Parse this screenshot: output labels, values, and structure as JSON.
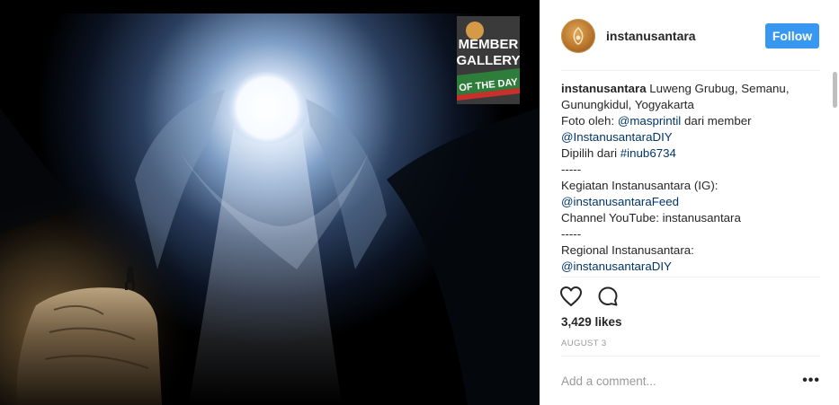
{
  "post": {
    "username": "instanusantara",
    "follow_label": "Follow",
    "badge": {
      "line1": "MEMBER",
      "line2": "GALLERY",
      "line3": "OF THE DAY"
    },
    "caption": {
      "author": "instanusantara",
      "first_text": " Luweng Grubug, Semanu,",
      "line2": "Gunungkidul, Yogyakarta",
      "line3_text": "Foto oleh: ",
      "line3_link": "@masprintil",
      "line3_suffix": " dari member",
      "line4_link": "@InstanusantaraDIY",
      "line5_text": "Dipilih dari ",
      "line5_link": "#inub6734",
      "line6": "-----",
      "line7": "Kegiatan Instanusantara (IG):",
      "line8_link": "@instanusantaraFeed",
      "line9": "Channel YouTube: instanusantara",
      "line10": "-----",
      "line11": "Regional Instanusantara:",
      "line12_link": "@instanusantaraDIY"
    },
    "likes": "3,429 likes",
    "date": "AUGUST 3",
    "comment_placeholder": "Add a comment...",
    "more_label": "•••"
  },
  "colors": {
    "follow_button": "#3897f0",
    "link": "#003569",
    "badge_green": "#2f7d3a",
    "badge_red": "#c9302c"
  },
  "icons": {
    "like": "heart-outline-icon",
    "comment": "speech-bubble-icon",
    "more": "ellipsis-icon"
  }
}
